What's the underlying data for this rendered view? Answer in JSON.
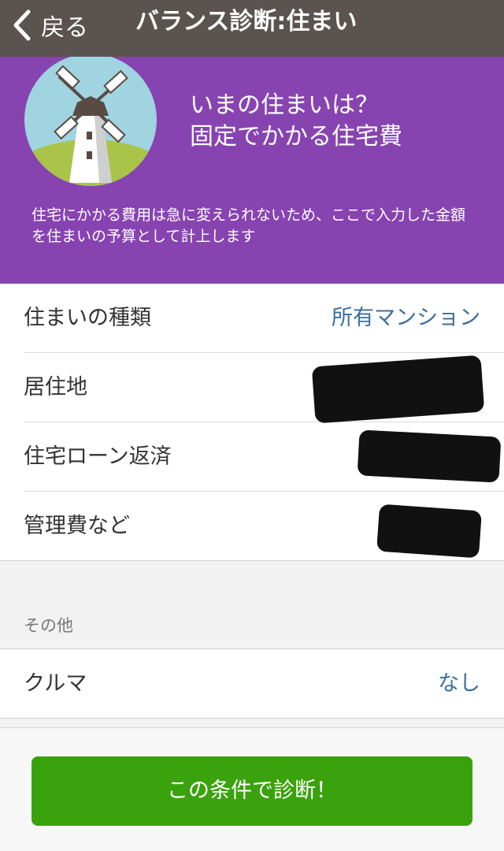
{
  "nav": {
    "back_label": "戻る",
    "title": "バランス診断:住まい"
  },
  "hero": {
    "title_line1": "いまの住まいは？",
    "title_line2": "固定でかかる住宅費",
    "description": "住宅にかかる費用は急に変えられないため、ここで入力した金額を住まいの予算として計上します"
  },
  "housing_rows": [
    {
      "label": "住まいの種類",
      "value": "所有マンション"
    },
    {
      "label": "居住地",
      "value": ""
    },
    {
      "label": "住宅ローン返済",
      "value": ""
    },
    {
      "label": "管理費など",
      "value": ""
    }
  ],
  "other_section": {
    "header": "その他",
    "rows": [
      {
        "label": "クルマ",
        "value": "なし"
      }
    ]
  },
  "cta_label": "この条件で診断！",
  "colors": {
    "nav_bg": "#5a5350",
    "hero_bg": "#8744b1",
    "value_text": "#3a6f9e",
    "cta_bg": "#3aa20c"
  }
}
